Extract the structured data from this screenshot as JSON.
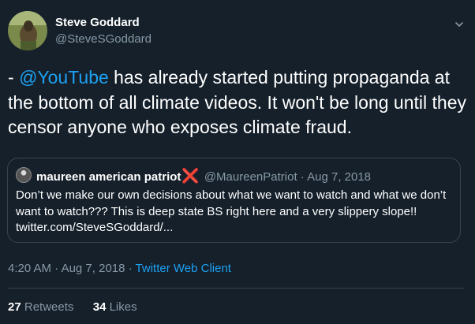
{
  "tweet": {
    "author_name": "Steve Goddard",
    "author_handle": "@SteveSGoddard",
    "text_prefix": "- ",
    "mention": "@YouTube",
    "text_body": " has already started putting propaganda at the bottom of all climate videos.  It won't be long until they censor anyone who exposes climate fraud.",
    "time": "4:20 AM",
    "date": "Aug 7, 2018",
    "separator": "·",
    "client": "Twitter Web Client"
  },
  "quoted_tweet": {
    "author_name": "maureen american patriot",
    "emoji": "❌",
    "author_handle": "@MaureenPatriot",
    "separator": "·",
    "date": "Aug 7, 2018",
    "text": "Don’t we make our own decisions about what we want to watch and what we don’t want to watch???  This is deep state BS right here and a very slippery slope!! twitter.com/SteveSGoddard/..."
  },
  "stats": {
    "retweets_count": "27",
    "retweets_label": "Retweets",
    "likes_count": "34",
    "likes_label": "Likes"
  },
  "colors": {
    "background": "#15202b",
    "accent": "#1da1f2",
    "muted": "#8899a6",
    "border": "#38444d"
  }
}
